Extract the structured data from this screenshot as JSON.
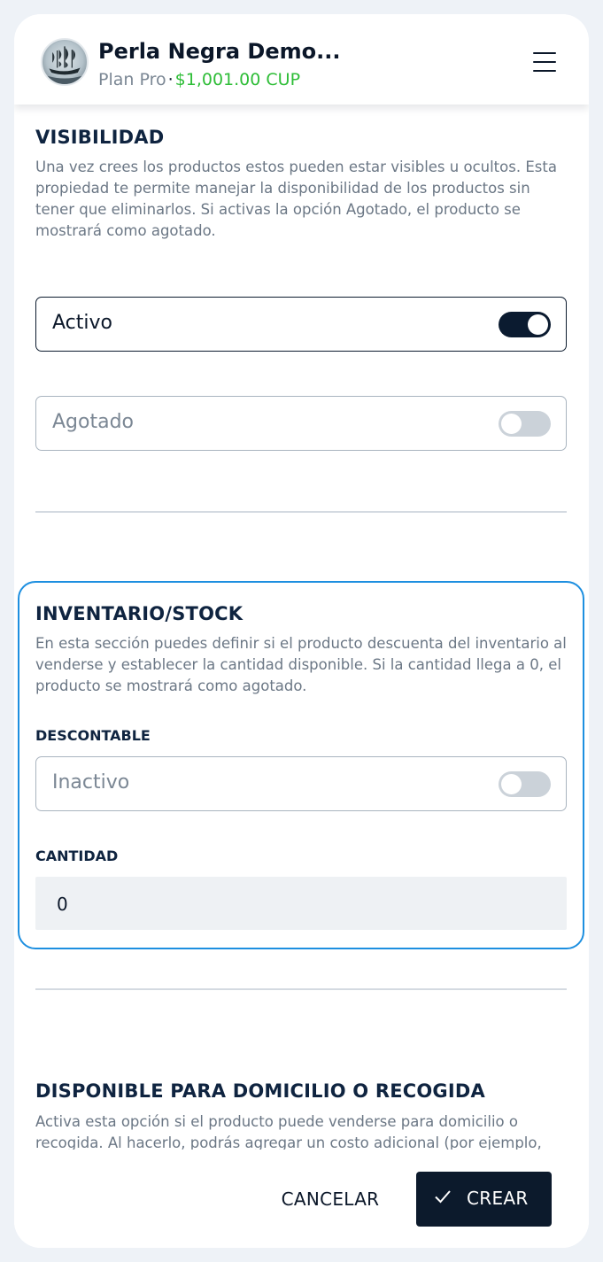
{
  "header": {
    "shop_name": "Perla Negra Demo...",
    "plan": "Plan Pro",
    "separator": "·",
    "balance": "$1,001.00 CUP"
  },
  "visibility": {
    "title": "VISIBILIDAD",
    "description": "Una vez crees los productos estos pueden estar visibles u ocultos. Esta propiedad te permite manejar la disponibilidad de los productos sin tener que eliminarlos. Si activas la opción Agotado, el producto se mostrará como agotado.",
    "active_label": "Activo",
    "active_on": true,
    "soldout_label": "Agotado",
    "soldout_on": false
  },
  "inventory": {
    "title": "INVENTARIO/STOCK",
    "description": "En esta sección puedes definir si el producto descuenta del inventario al venderse y establecer la cantidad disponible. Si la cantidad llega a 0, el producto se mostrará como agotado.",
    "discountable_label": "DESCONTABLE",
    "discountable_value": "Inactivo",
    "discountable_on": false,
    "quantity_label": "CANTIDAD",
    "quantity_value": "0"
  },
  "delivery": {
    "title": "DISPONIBLE PARA DOMICILIO O RECOGIDA",
    "description": "Activa esta opción si el producto puede venderse para domicilio o recogida. Al hacerlo, podrás agregar un costo adicional (por ejemplo,"
  },
  "actions": {
    "cancel_label": "CANCELAR",
    "create_label": "CREAR"
  },
  "colors": {
    "accent": "#1d8fe0",
    "dark": "#0c1a2c",
    "balance": "#2ebd37"
  },
  "icons": [
    "ship-logo-icon",
    "menu-icon",
    "check-icon"
  ]
}
